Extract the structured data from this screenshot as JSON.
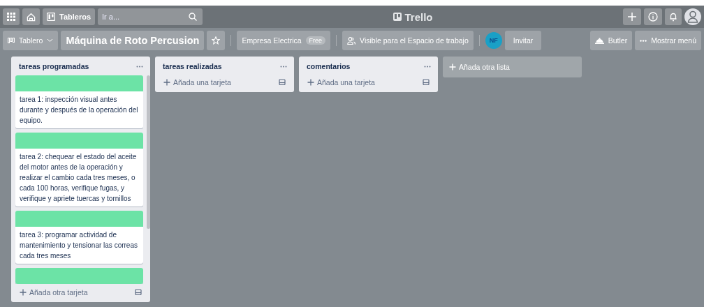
{
  "header": {
    "boards_button": "Tableros",
    "search": {
      "placeholder": "Ir a..."
    },
    "logo": "Trello"
  },
  "board_bar": {
    "view_button": "Tablero",
    "board_name": "Máquina de Roto Percusion",
    "starred": false,
    "workspace": "Empresa Electrica",
    "plan_badge": "Free",
    "visibility": "Visible para el Espacio de trabajo",
    "member_initials": "NF",
    "invite_button": "Invitar",
    "butler_button": "Butler",
    "menu_button": "Mostrar menú"
  },
  "lists": [
    {
      "title": "tareas programadas",
      "cards": [
        {
          "kind": "text",
          "text": "tarea 1: inspección visual antes durante y después de la operación del equipo."
        },
        {
          "kind": "text",
          "text": "tarea 2: chequear el estado del aceite del motor antes de la operación y realizar el cambio cada tres meses, o cada 100 horas, verifique fugas, y verifique y apriete tuercas y tornillos"
        },
        {
          "kind": "text",
          "text": "tarea 3: programar actividad de mantenimiento y tensionar las correas cada tres meses"
        },
        {
          "kind": "cover"
        }
      ],
      "add_card": "Añada otra tarjeta"
    },
    {
      "title": "tareas realizadas",
      "add_card": "Añada una tarjeta"
    },
    {
      "title": "comentarios",
      "add_card": "Añada una tarjeta"
    }
  ],
  "add_list": "Añada otra lista"
}
